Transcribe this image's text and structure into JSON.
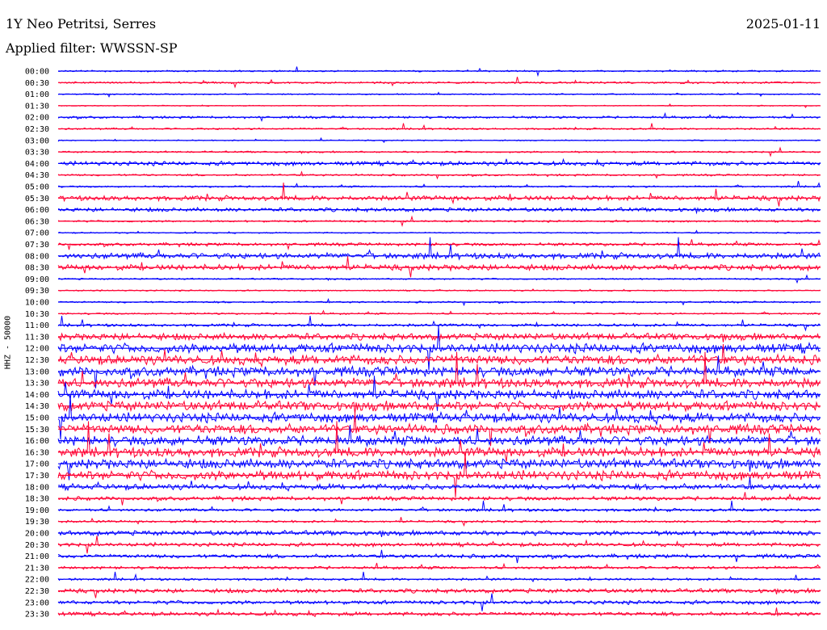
{
  "header": {
    "station": "1Y Neo Petritsi, Serres",
    "date": "2025-01-11",
    "filter": "Applied filter: WWSSN-SP"
  },
  "chart_data": {
    "type": "line",
    "title": "1Y Neo Petritsi, Serres",
    "ylabel": "HHZ - 50000",
    "trace_colors": [
      "#0000ff",
      "#ff0033"
    ],
    "tick_labels": [
      "00:00",
      "00:30",
      "01:00",
      "01:30",
      "02:00",
      "02:30",
      "03:00",
      "03:30",
      "04:00",
      "04:30",
      "05:00",
      "05:30",
      "06:00",
      "06:30",
      "07:00",
      "07:30",
      "08:00",
      "08:30",
      "09:00",
      "09:30",
      "10:00",
      "10:30",
      "11:00",
      "11:30",
      "12:00",
      "12:30",
      "13:00",
      "13:30",
      "14:00",
      "14:30",
      "15:00",
      "15:30",
      "16:00",
      "16:30",
      "17:00",
      "17:30",
      "18:00",
      "18:30",
      "19:00",
      "19:30",
      "20:00",
      "20:30",
      "21:00",
      "21:30",
      "22:00",
      "22:30",
      "23:00",
      "23:30"
    ],
    "noise_level": [
      0.8,
      1,
      0.6,
      0.5,
      1.2,
      0.9,
      0.6,
      0.9,
      2.2,
      1,
      0.9,
      2.5,
      2,
      1,
      0.7,
      1.6,
      3,
      3,
      0.8,
      0.7,
      0.9,
      0.9,
      1.5,
      3.5,
      5,
      5,
      5,
      5,
      5,
      5,
      5,
      5,
      5,
      5,
      5,
      5,
      3,
      2,
      1.5,
      1.2,
      2.5,
      2,
      2,
      1.5,
      1.2,
      2.2,
      2,
      2
    ]
  }
}
